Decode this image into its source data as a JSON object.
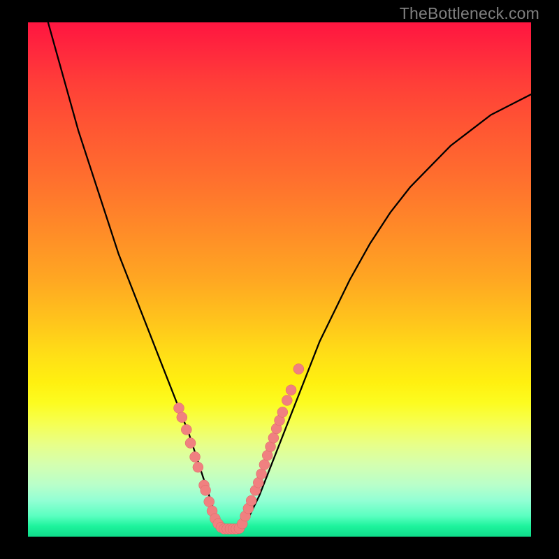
{
  "watermark": "TheBottleneck.com",
  "colors": {
    "frame_bg": "#000000",
    "curve_stroke": "#000000",
    "marker_fill": "#f08080",
    "marker_stroke": "#dd6666"
  },
  "chart_data": {
    "type": "line",
    "title": "",
    "xlabel": "",
    "ylabel": "",
    "xlim": [
      0,
      100
    ],
    "ylim": [
      0,
      100
    ],
    "grid": false,
    "legend": false,
    "series": [
      {
        "name": "curve",
        "x": [
          4,
          6,
          8,
          10,
          12,
          14,
          16,
          18,
          20,
          22,
          24,
          26,
          28,
          30,
          32,
          34,
          35,
          36,
          37,
          38,
          39,
          40,
          41,
          42,
          44,
          46,
          48,
          50,
          52,
          54,
          56,
          58,
          60,
          64,
          68,
          72,
          76,
          80,
          84,
          88,
          92,
          96,
          100
        ],
        "y": [
          100,
          93,
          86,
          79,
          73,
          67,
          61,
          55,
          50,
          45,
          40,
          35,
          30,
          25,
          20,
          14,
          11,
          8,
          5,
          3,
          2,
          1.5,
          1.5,
          2,
          4,
          8,
          13,
          18,
          23,
          28,
          33,
          38,
          42,
          50,
          57,
          63,
          68,
          72,
          76,
          79,
          82,
          84,
          86
        ]
      }
    ],
    "markers": {
      "left_branch": [
        {
          "x": 30,
          "y": 25
        },
        {
          "x": 30.6,
          "y": 23.2
        },
        {
          "x": 31.5,
          "y": 20.8
        },
        {
          "x": 32.3,
          "y": 18.2
        },
        {
          "x": 33.2,
          "y": 15.5
        },
        {
          "x": 33.8,
          "y": 13.5
        },
        {
          "x": 35,
          "y": 10
        },
        {
          "x": 35.3,
          "y": 9
        },
        {
          "x": 36,
          "y": 6.8
        },
        {
          "x": 36.6,
          "y": 5
        },
        {
          "x": 37.2,
          "y": 3.5
        },
        {
          "x": 37.8,
          "y": 2.5
        },
        {
          "x": 38.4,
          "y": 1.8
        }
      ],
      "bottom_flat": [
        {
          "x": 39,
          "y": 1.5
        },
        {
          "x": 39.6,
          "y": 1.5
        },
        {
          "x": 40.2,
          "y": 1.5
        },
        {
          "x": 40.8,
          "y": 1.5
        },
        {
          "x": 41.4,
          "y": 1.5
        },
        {
          "x": 42,
          "y": 1.6
        }
      ],
      "right_branch": [
        {
          "x": 42.6,
          "y": 2.5
        },
        {
          "x": 43.2,
          "y": 4
        },
        {
          "x": 43.8,
          "y": 5.5
        },
        {
          "x": 44.4,
          "y": 7
        },
        {
          "x": 45.2,
          "y": 9
        },
        {
          "x": 45.8,
          "y": 10.5
        },
        {
          "x": 46.4,
          "y": 12.2
        },
        {
          "x": 47,
          "y": 14
        },
        {
          "x": 47.6,
          "y": 15.8
        },
        {
          "x": 48.2,
          "y": 17.5
        },
        {
          "x": 48.8,
          "y": 19.2
        },
        {
          "x": 49.4,
          "y": 21
        },
        {
          "x": 50,
          "y": 22.6
        },
        {
          "x": 50.6,
          "y": 24.2
        },
        {
          "x": 51.5,
          "y": 26.5
        },
        {
          "x": 52.3,
          "y": 28.5
        },
        {
          "x": 53.8,
          "y": 32.6
        }
      ]
    }
  }
}
